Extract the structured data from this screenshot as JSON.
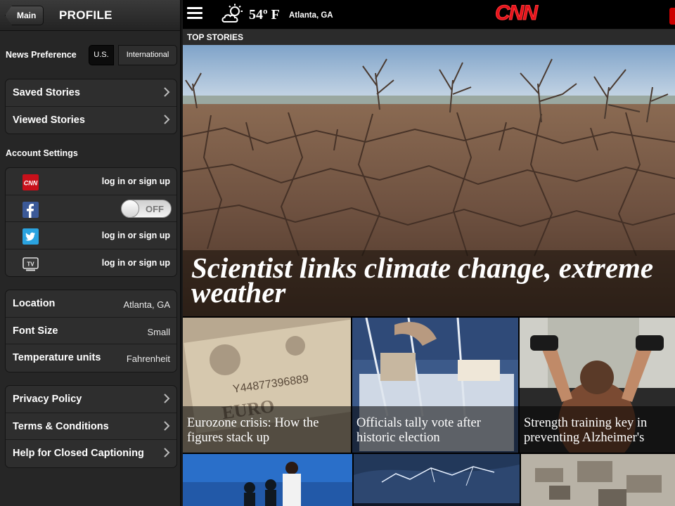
{
  "sidebar": {
    "back_label": "Main",
    "title": "PROFILE",
    "news_preference": {
      "label": "News Preference",
      "options": [
        "U.S.",
        "International"
      ],
      "selected": "U.S."
    },
    "stories": [
      {
        "label": "Saved Stories"
      },
      {
        "label": "Viewed Stories"
      }
    ],
    "account_settings": {
      "label": "Account Settings",
      "rows": [
        {
          "icon": "cnn-icon",
          "action": "log in or sign up"
        },
        {
          "icon": "facebook-icon",
          "toggle": "OFF"
        },
        {
          "icon": "twitter-icon",
          "action": "log in or sign up"
        },
        {
          "icon": "tv-icon",
          "action": "log in or sign up"
        }
      ]
    },
    "settings": [
      {
        "label": "Location",
        "value": "Atlanta, GA"
      },
      {
        "label": "Font Size",
        "value": "Small"
      },
      {
        "label": "Temperature units",
        "value": "Fahrenheit"
      }
    ],
    "info": [
      {
        "label": "Privacy Policy"
      },
      {
        "label": "Terms & Conditions"
      },
      {
        "label": "Help for Closed Captioning"
      }
    ]
  },
  "topbar": {
    "temperature": "54º F",
    "city": "Atlanta, GA",
    "logo": "CNN",
    "weather_icon": "partly-cloudy-icon"
  },
  "section": {
    "label": "TOP STORIES"
  },
  "hero": {
    "headline": "Scientist links climate change, extreme weather"
  },
  "stories": [
    {
      "caption": "Eurozone crisis: How the figures stack up"
    },
    {
      "caption": "Officials tally vote after historic election"
    },
    {
      "caption": "Strength training key in preventing Alzheimer's"
    }
  ],
  "colors": {
    "brand_red": "#e5121b",
    "sidebar_bg": "#262626"
  }
}
